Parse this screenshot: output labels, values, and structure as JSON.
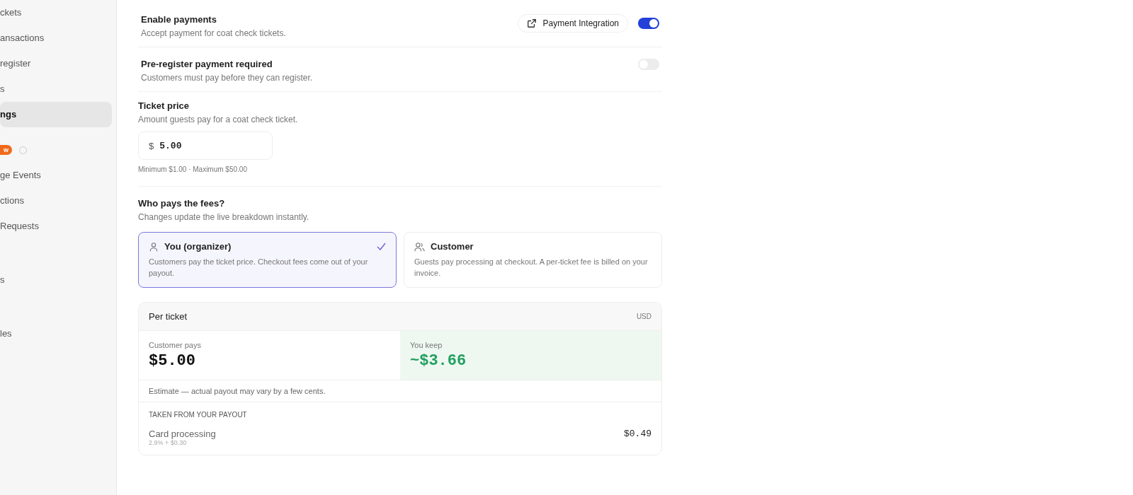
{
  "sidebar": {
    "items": [
      {
        "kind": "item",
        "label": "ckets",
        "selected": false
      },
      {
        "kind": "item",
        "label": "ansactions",
        "selected": false
      },
      {
        "kind": "item",
        "label": "register",
        "selected": false
      },
      {
        "kind": "item",
        "label": "s",
        "selected": false
      },
      {
        "kind": "item",
        "label": "ngs",
        "selected": true
      },
      {
        "kind": "badge",
        "label": "w",
        "selected": false
      },
      {
        "kind": "item",
        "label": "ge Events",
        "selected": false
      },
      {
        "kind": "item",
        "label": "ctions",
        "selected": false
      },
      {
        "kind": "item",
        "label": "Requests",
        "selected": false
      },
      {
        "kind": "gap-item",
        "label": "s",
        "selected": false
      },
      {
        "kind": "gap-item",
        "label": "les",
        "selected": false
      }
    ]
  },
  "settings": [
    {
      "kind": "toggle",
      "title": "Enable payments",
      "description": "Accept payment for coat check tickets.",
      "link": "Payment Integration",
      "on": true
    },
    {
      "kind": "toggle",
      "title": "Pre-register payment required",
      "description": "Customers must pay before they can register.",
      "on": false
    }
  ],
  "ticket_price": {
    "title": "Ticket price",
    "description": "Amount guests pay for a coat check ticket.",
    "currency": "$",
    "value": "5.00",
    "hint": "Minimum $1.00 · Maximum $50.00"
  },
  "fees": {
    "title": "Who pays the fees?",
    "description": "Changes update the live breakdown instantly.",
    "options": [
      {
        "kind": "single",
        "title": "You (organizer)",
        "description": "Customers pay the ticket price. Checkout fees come out of your payout.",
        "selected": true
      },
      {
        "kind": "group",
        "title": "Customer",
        "description": "Guests pay processing at checkout. A per-ticket fee is billed on your invoice.",
        "selected": false
      }
    ]
  },
  "breakdown": {
    "title": "Per ticket",
    "currency": "USD",
    "customer_pays": {
      "label": "Customer pays",
      "amount": "$5.00"
    },
    "you_keep": {
      "label": "You keep",
      "amount": "~$3.66"
    },
    "note": "Estimate — actual payout may vary by a few cents.",
    "section_title": "TAKEN FROM YOUR PAYOUT",
    "lines": [
      {
        "label": "Card processing",
        "detail": "2.9% + $0.30",
        "amount": "$0.49"
      }
    ]
  }
}
